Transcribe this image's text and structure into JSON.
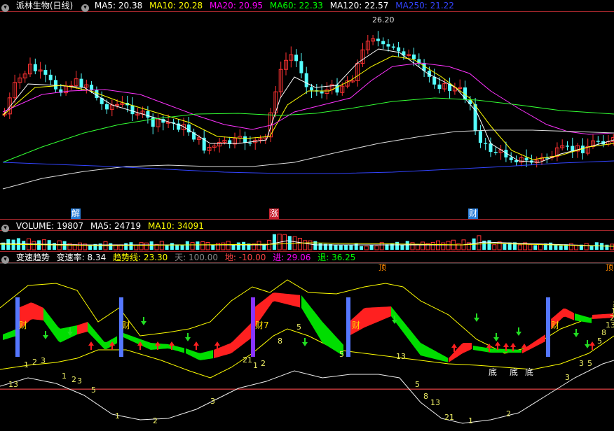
{
  "price_panel": {
    "stock_title": "派林生物(日线)",
    "ma_items": [
      {
        "label": "MA5: 20.38",
        "color": "#ffffff"
      },
      {
        "label": "MA10: 20.28",
        "color": "#ffff00"
      },
      {
        "label": "MA20: 20.95",
        "color": "#ff00ff"
      },
      {
        "label": "MA60: 22.33",
        "color": "#00ff00"
      },
      {
        "label": "MA120: 22.57",
        "color": "#ffffff"
      },
      {
        "label": "MA250: 21.22",
        "color": "#3333ff"
      }
    ],
    "peak_label": "26.20",
    "event_markers": [
      {
        "text": "解",
        "bg": "#2a7dd8"
      },
      {
        "text": "涨",
        "bg": "#c8202f"
      },
      {
        "text": "财",
        "bg": "#2a7dd8"
      }
    ]
  },
  "volume_panel": {
    "items": [
      {
        "label": "VOLUME: 19807",
        "color": "#ffffff"
      },
      {
        "label": "MA5: 24719",
        "color": "#ffffff"
      },
      {
        "label": "MA10: 34091",
        "color": "#ffff00"
      }
    ]
  },
  "indicator_panel": {
    "name": "变速趋势",
    "items": [
      {
        "label": "变速率: 8.34",
        "color": "#ffffff"
      },
      {
        "label": "趋势线: 23.30",
        "color": "#ffff00"
      },
      {
        "label": "天: 100.00",
        "color": "#888888"
      },
      {
        "label": "地: -10.00",
        "color": "#ff4444"
      },
      {
        "label": "进: 29.06",
        "color": "#ff00ff"
      },
      {
        "label": "退: 36.25",
        "color": "#00ff00"
      }
    ],
    "top_marks": [
      {
        "text": "顶"
      },
      {
        "text": "顶"
      }
    ],
    "cai_marks": [
      {
        "text": "财"
      },
      {
        "text": "财"
      },
      {
        "text": "财7"
      },
      {
        "text": "财"
      },
      {
        "text": "财"
      }
    ],
    "bottom_marks": [
      {
        "text": "底"
      },
      {
        "text": "底"
      },
      {
        "text": "底"
      }
    ],
    "upper_numbers": [
      "1",
      "2",
      "3",
      "5",
      "8",
      "5",
      "13",
      "21",
      "1",
      "2",
      "3",
      "5"
    ],
    "lower_numbers": [
      "13",
      "1",
      "2",
      "3",
      "5",
      "1",
      "2",
      "3",
      "5",
      "8",
      "13",
      "21",
      "1",
      "2",
      "3",
      "5",
      "8",
      "13",
      "21",
      "1",
      "2",
      "3"
    ]
  },
  "chart_data": {
    "type": "line",
    "title": "派林生物(日线)",
    "series": [
      {
        "name": "MA5",
        "last": 20.38
      },
      {
        "name": "MA10",
        "last": 20.28
      },
      {
        "name": "MA20",
        "last": 20.95
      },
      {
        "name": "MA60",
        "last": 22.33
      },
      {
        "name": "MA120",
        "last": 22.57
      },
      {
        "name": "MA250",
        "last": 21.22
      },
      {
        "name": "VOLUME",
        "last": 19807
      },
      {
        "name": "变速率",
        "last": 8.34
      },
      {
        "name": "趋势线",
        "last": 23.3
      }
    ],
    "price_high_label": 26.2,
    "grid": false,
    "legend": "top-left"
  }
}
